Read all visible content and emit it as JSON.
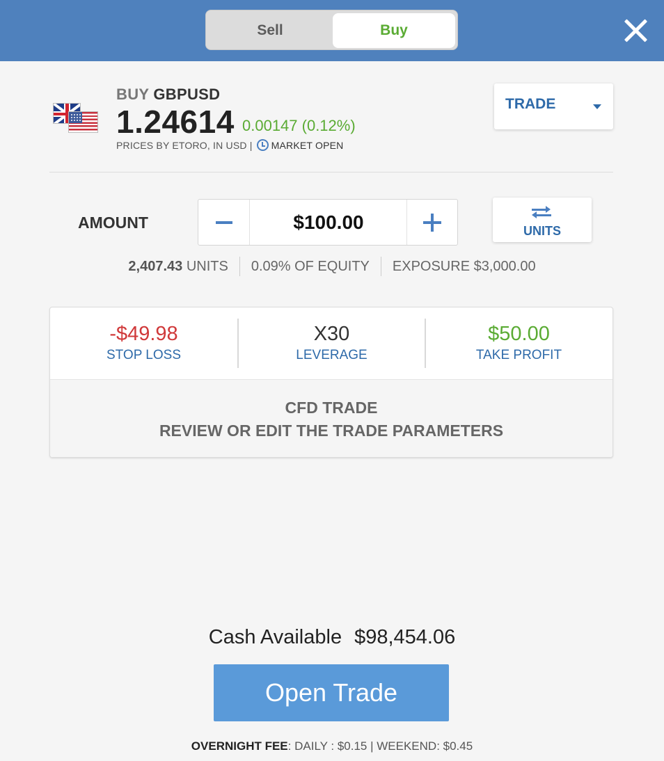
{
  "header": {
    "sell_label": "Sell",
    "buy_label": "Buy",
    "close_icon": "close-icon",
    "colors": {
      "bar": "#4f81bd",
      "buy_active": "#5aab33"
    }
  },
  "instrument": {
    "action": "BUY",
    "symbol": "GBPUSD",
    "price": "1.24614",
    "change": "0.00147 (0.12%)",
    "prices_by": "PRICES BY ETORO, IN USD |",
    "market_status": "MARKET OPEN",
    "flag_icon": "gbp-usd-flags-icon"
  },
  "trade_dropdown": {
    "selected": "TRADE"
  },
  "amount": {
    "label": "AMOUNT",
    "value": "$100.00",
    "units_button": "UNITS"
  },
  "info": {
    "units_value": "2,407.43",
    "units_label": "UNITS",
    "equity": "0.09% OF EQUITY",
    "exposure": "EXPOSURE $3,000.00"
  },
  "params": {
    "stop_loss": {
      "value": "-$49.98",
      "label": "STOP LOSS"
    },
    "leverage": {
      "value": "X30",
      "label": "LEVERAGE"
    },
    "take_profit": {
      "value": "$50.00",
      "label": "TAKE PROFIT"
    },
    "cfd_title": "CFD TRADE",
    "cfd_subtitle": "REVIEW OR EDIT THE TRADE PARAMETERS"
  },
  "footer": {
    "cash_label": "Cash Available",
    "cash_value": "$98,454.06",
    "open_button": "Open Trade",
    "fee_label": "OVERNIGHT FEE",
    "fee_details": ": DAILY : $0.15 | WEEKEND: $0.45"
  }
}
